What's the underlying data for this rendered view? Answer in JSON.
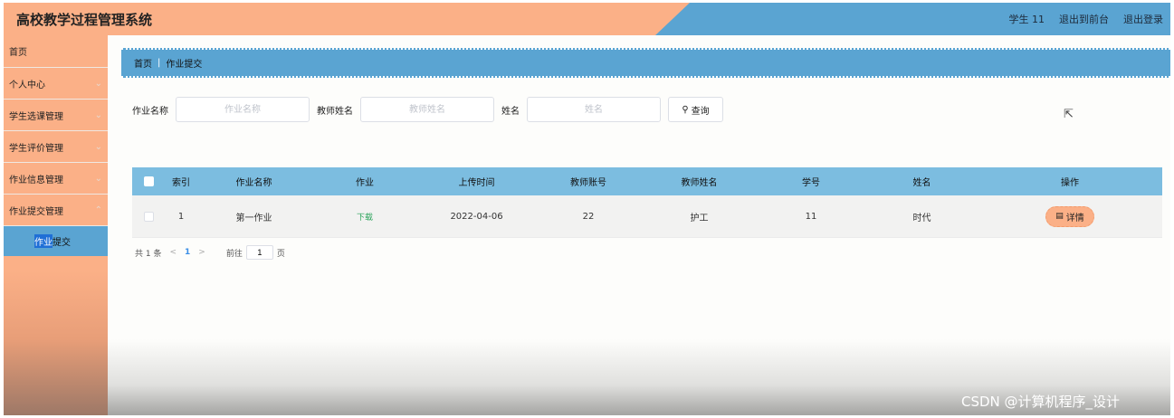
{
  "header": {
    "app_title": "高校教学过程管理系统",
    "user": "学生 11",
    "back_to_front": "退出到前台",
    "logout": "退出登录"
  },
  "sidebar": {
    "items": [
      {
        "label": "首页",
        "has_chevron": false
      },
      {
        "label": "个人中心",
        "has_chevron": true
      },
      {
        "label": "学生选课管理",
        "has_chevron": true
      },
      {
        "label": "学生评价管理",
        "has_chevron": true
      },
      {
        "label": "作业信息管理",
        "has_chevron": true
      },
      {
        "label": "作业提交管理",
        "has_chevron": true
      }
    ],
    "submenu": {
      "highlight": "作业",
      "rest": "提交"
    }
  },
  "breadcrumb": {
    "home": "首页",
    "separator": "|",
    "current": "作业提交"
  },
  "search": {
    "homework_label": "作业名称",
    "homework_placeholder": "作业名称",
    "teacher_label": "教师姓名",
    "teacher_placeholder": "教师姓名",
    "name_label": "姓名",
    "name_placeholder": "姓名",
    "button": "查询"
  },
  "table": {
    "headers": [
      "索引",
      "作业名称",
      "作业",
      "上传时间",
      "教师账号",
      "教师姓名",
      "学号",
      "姓名",
      "操作"
    ],
    "rows": [
      {
        "index": "1",
        "homework_name": "第一作业",
        "homework": "下载",
        "upload_time": "2022-04-06",
        "teacher_account": "22",
        "teacher_name": "护工",
        "student_id": "11",
        "student_name": "时代",
        "action": "详情"
      }
    ]
  },
  "pagination": {
    "total": "共 1 条",
    "prev": "<",
    "current": "1",
    "next": ">",
    "goto_label": "前往",
    "page_value": "1",
    "suffix": "页"
  },
  "watermark": "CSDN @计算机程序_设计",
  "colors": {
    "accent_orange": "#fbb087",
    "accent_blue": "#5aa4d2",
    "table_header": "#7cbde0",
    "download_green": "#2aa35a"
  }
}
